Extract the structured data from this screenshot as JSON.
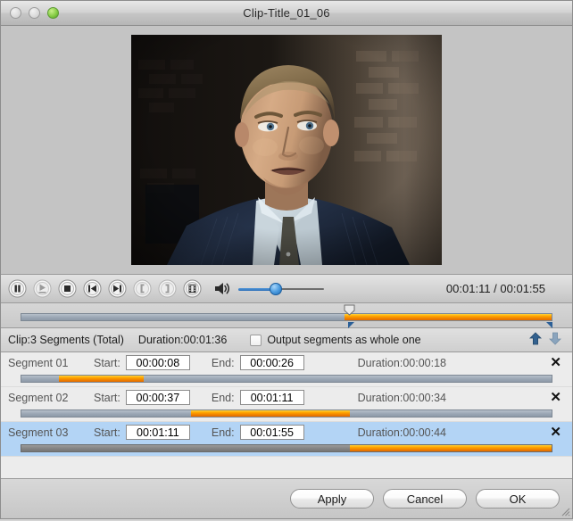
{
  "window": {
    "title": "Clip-Title_01_06",
    "controls": [
      "close",
      "minimize",
      "zoom"
    ]
  },
  "preview": {
    "description": "video-preview-frame"
  },
  "transport": {
    "buttons": [
      {
        "name": "pause-button",
        "icon": "pause-icon",
        "enabled": true
      },
      {
        "name": "play-export-button",
        "icon": "play-export-icon",
        "enabled": false
      },
      {
        "name": "stop-button",
        "icon": "stop-icon",
        "enabled": true
      },
      {
        "name": "previous-frame-button",
        "icon": "skip-back-icon",
        "enabled": true
      },
      {
        "name": "next-frame-button",
        "icon": "skip-forward-icon",
        "enabled": true
      },
      {
        "name": "mark-in-button",
        "icon": "bracket-left-icon",
        "enabled": false
      },
      {
        "name": "mark-out-button",
        "icon": "bracket-right-icon",
        "enabled": false
      },
      {
        "name": "filmstrip-button",
        "icon": "filmstrip-icon",
        "enabled": true
      }
    ],
    "volume_icon": "speaker-icon",
    "volume_percent": 40,
    "time_current": "00:01:11",
    "time_separator": "/",
    "time_total": "00:01:55",
    "time_readout": "00:01:11 / 00:01:55"
  },
  "main_timeline": {
    "playhead_percent": 61,
    "selection_start_percent": 61,
    "selection_end_percent": 100
  },
  "infobar": {
    "clip_label": "Clip:3 Segments (Total)",
    "duration_label": "Duration:00:01:36",
    "checkbox_label": "Output segments as whole one",
    "checkbox_checked": false,
    "move_up_icon": "arrow-up-icon",
    "move_down_icon": "arrow-down-icon"
  },
  "segments": {
    "start_label": "Start:",
    "end_label": "End:",
    "delete_glyph": "✕",
    "rows": [
      {
        "name": "Segment 01",
        "start": "00:00:08",
        "end": "00:00:26",
        "duration": "Duration:00:00:18",
        "bar_start_percent": 7,
        "bar_end_percent": 23,
        "selected": false
      },
      {
        "name": "Segment 02",
        "start": "00:00:37",
        "end": "00:01:11",
        "duration": "Duration:00:00:34",
        "bar_start_percent": 32,
        "bar_end_percent": 62,
        "selected": false
      },
      {
        "name": "Segment 03",
        "start": "00:01:11",
        "end": "00:01:55",
        "duration": "Duration:00:00:44",
        "bar_start_percent": 62,
        "bar_end_percent": 100,
        "selected": true
      }
    ]
  },
  "footer": {
    "apply_label": "Apply",
    "cancel_label": "Cancel",
    "ok_label": "OK"
  },
  "colors": {
    "accent_orange": "#f09000",
    "selection_blue": "#b3d4f5",
    "track_grey": "#98a4b2",
    "volume_blue": "#2d6fb8",
    "window_chrome": "#d0d0d0"
  }
}
